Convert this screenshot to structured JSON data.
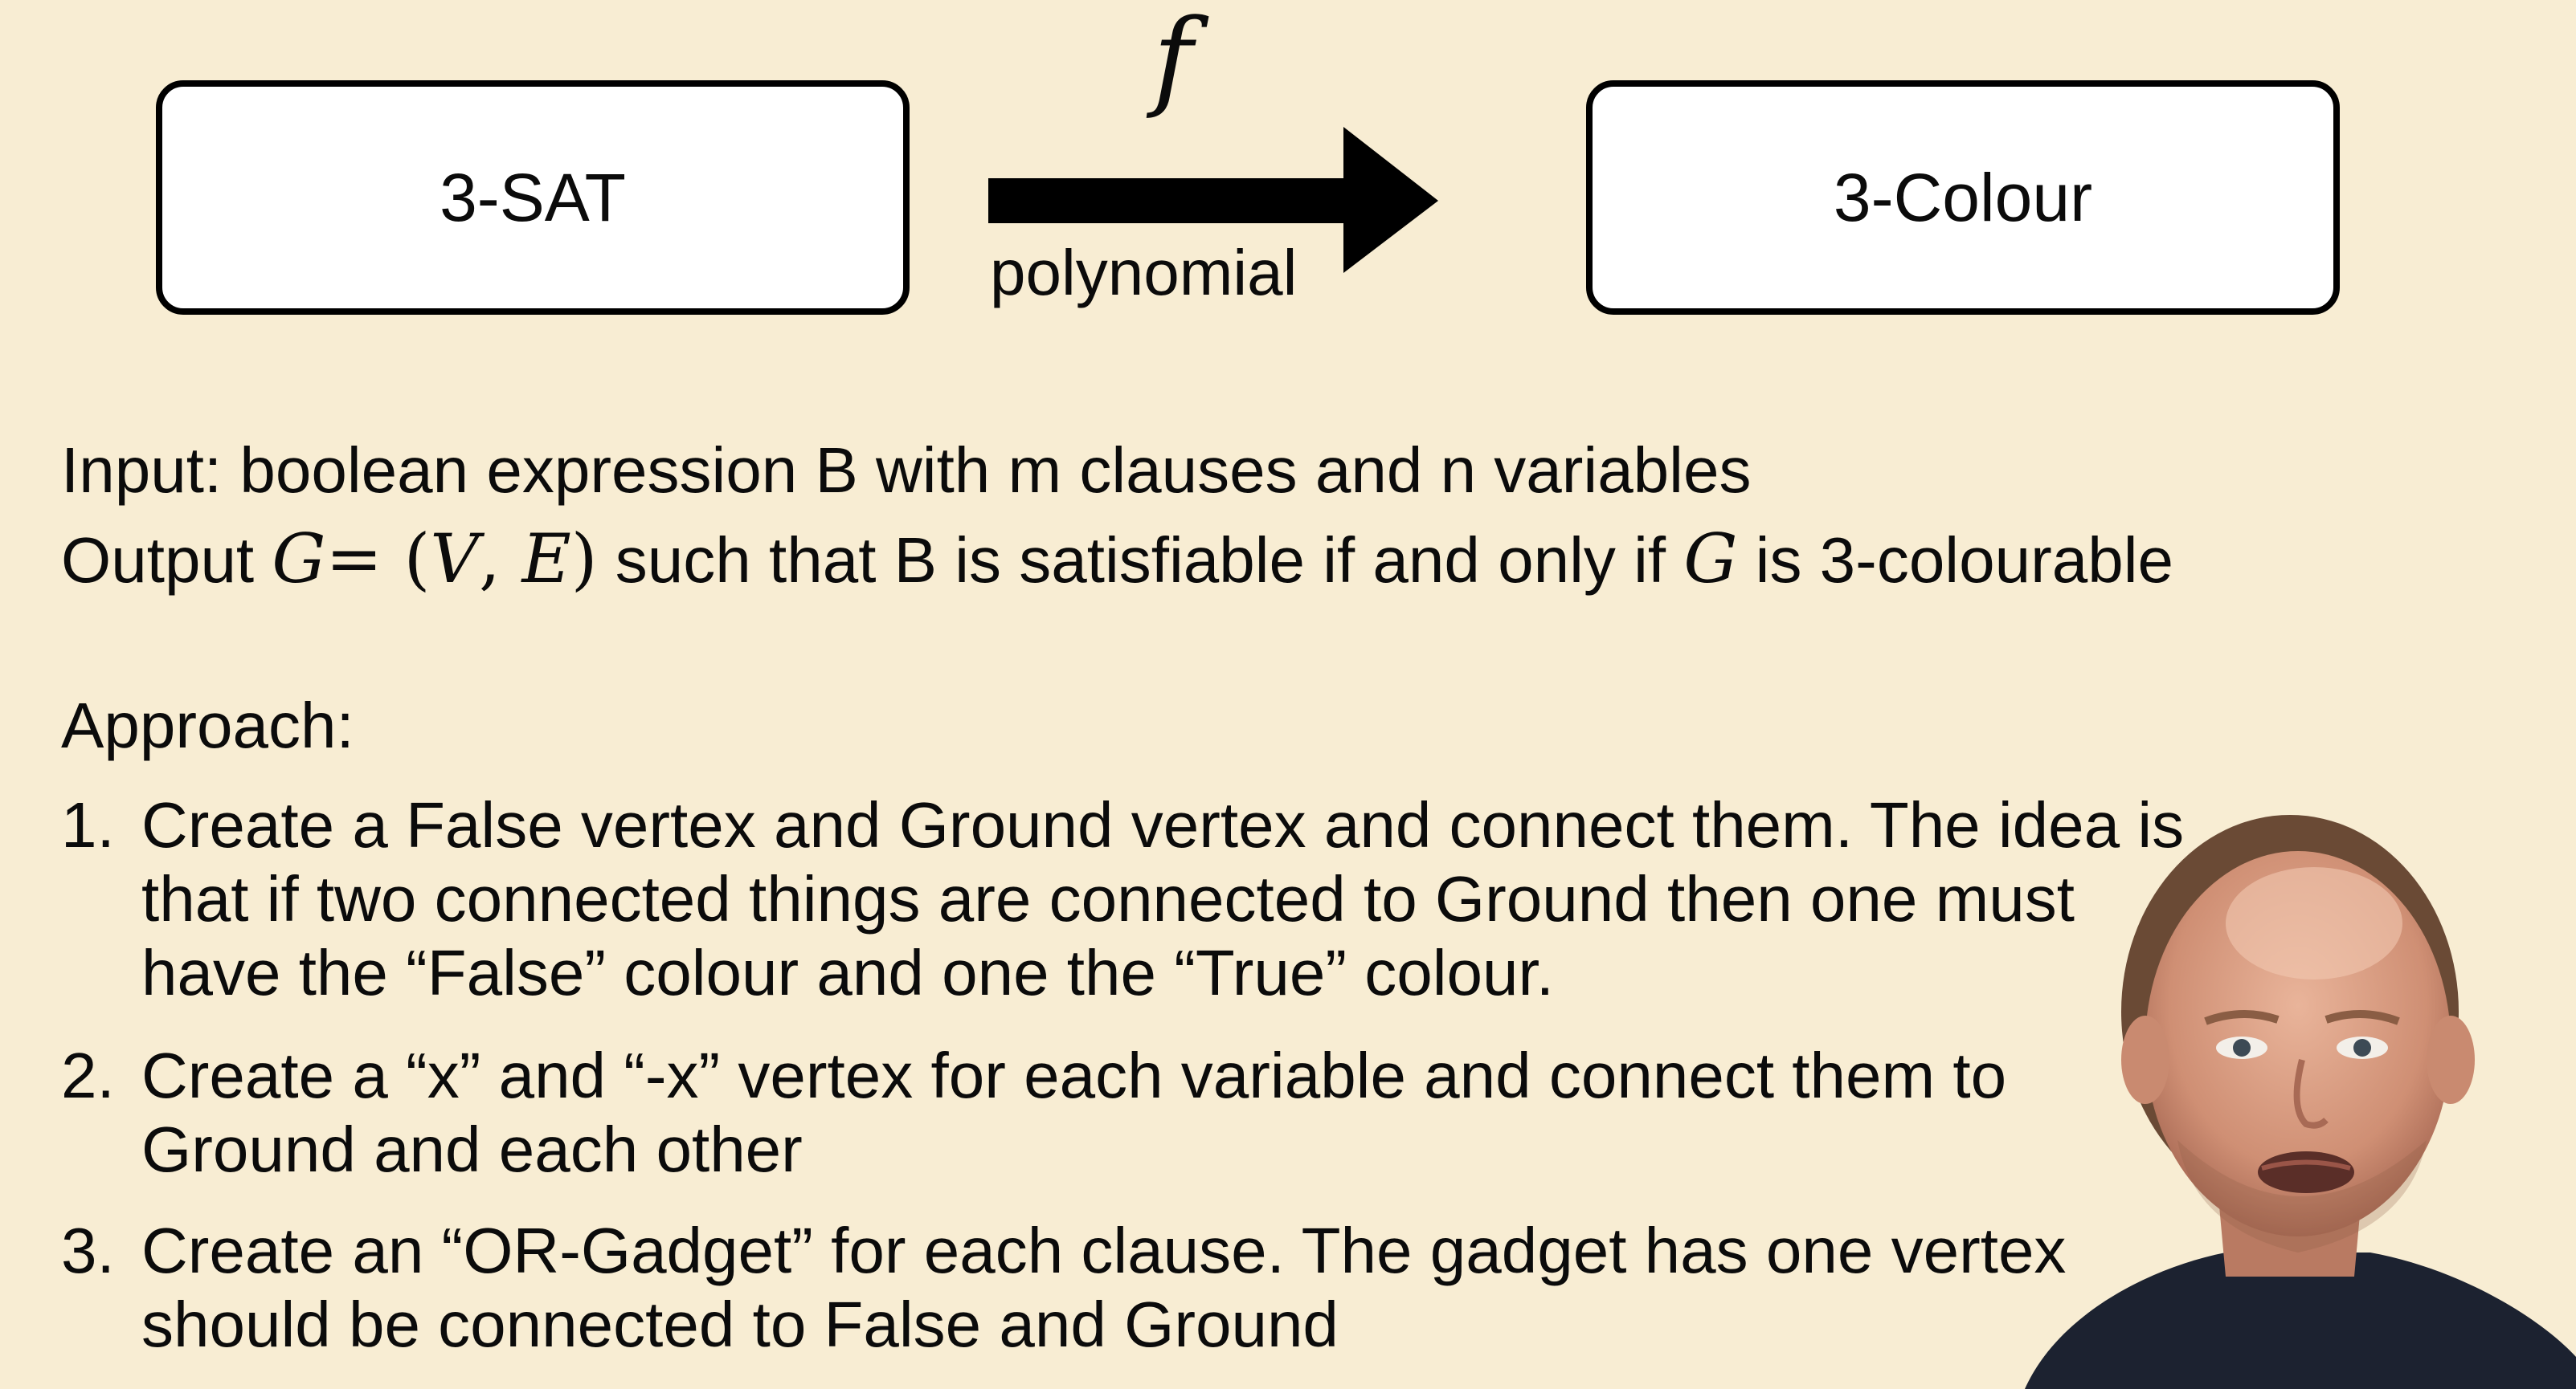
{
  "diagram": {
    "left_box_label": "3-SAT",
    "right_box_label": "3-Colour",
    "arrow_symbol": "f",
    "arrow_caption": "polynomial"
  },
  "problem": {
    "input_text": "Input: boolean expression B with m clauses and n variables",
    "output_prefix": "Output",
    "output_math_G": "G",
    "output_math_eq": "= (",
    "output_math_V": "V",
    "output_math_comma": ", ",
    "output_math_E": "E",
    "output_math_close": ")",
    "output_middle": " such that B is satisfiable if and only if ",
    "output_math_G2": "G",
    "output_suffix": " is 3-colourable"
  },
  "approach": {
    "heading": "Approach:",
    "steps": [
      {
        "number": "1.",
        "lines": [
          "Create a False vertex and Ground vertex and connect them. The idea is",
          "that if two connected things are connected to Ground then one must",
          "have the “False” colour and one the “True” colour."
        ]
      },
      {
        "number": "2.",
        "lines": [
          "Create a “x” and “-x” vertex for each variable and connect them to",
          "Ground and each other"
        ]
      },
      {
        "number": "3.",
        "lines": [
          "Create an “OR-Gadget” for each clause. The gadget has one vertex",
          "should be connected to False and Ground"
        ]
      }
    ]
  },
  "colors": {
    "background": "#f8edd3",
    "box_fill": "#ffffff",
    "stroke": "#000000"
  },
  "webcam": {
    "icon": "presenter-video-icon"
  }
}
